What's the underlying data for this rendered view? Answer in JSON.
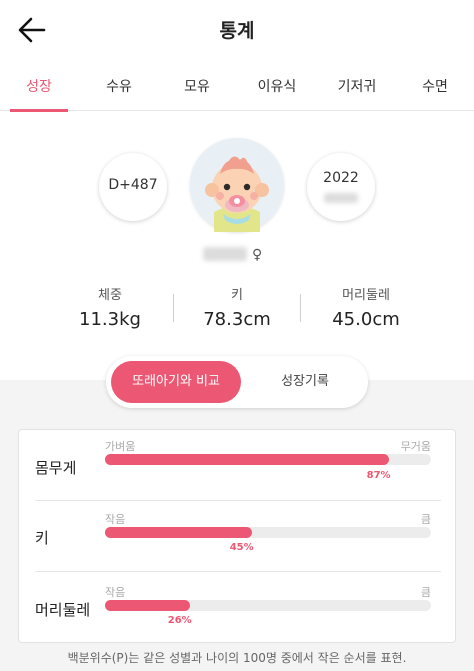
{
  "header": {
    "title": "통계"
  },
  "tabs": [
    {
      "label": "성장",
      "active": true
    },
    {
      "label": "수유",
      "active": false
    },
    {
      "label": "모유",
      "active": false
    },
    {
      "label": "이유식",
      "active": false
    },
    {
      "label": "기저귀",
      "active": false
    },
    {
      "label": "수면",
      "active": false
    }
  ],
  "profile": {
    "dday": "D+487",
    "year": "2022",
    "gender_symbol": "♀"
  },
  "stats": [
    {
      "label": "체중",
      "value": "11.3kg"
    },
    {
      "label": "키",
      "value": "78.3cm"
    },
    {
      "label": "머리둘레",
      "value": "45.0cm"
    }
  ],
  "toggle": {
    "active": "또래아기와 비교",
    "inactive": "성장기록"
  },
  "comparison": [
    {
      "label": "몸무게",
      "low": "가벼움",
      "high": "무거움",
      "percentile": 87,
      "percent_text": "87%"
    },
    {
      "label": "키",
      "low": "작음",
      "high": "큼",
      "percentile": 45,
      "percent_text": "45%"
    },
    {
      "label": "머리둘레",
      "low": "작음",
      "high": "큼",
      "percentile": 26,
      "percent_text": "26%"
    }
  ],
  "footnote": "백분위수(P)는 같은 성별과 나이의 100명 중에서 작은 순서를 표현.",
  "colors": {
    "accent": "#ec5873",
    "track": "#ececec",
    "background": "#f4f4f4"
  }
}
